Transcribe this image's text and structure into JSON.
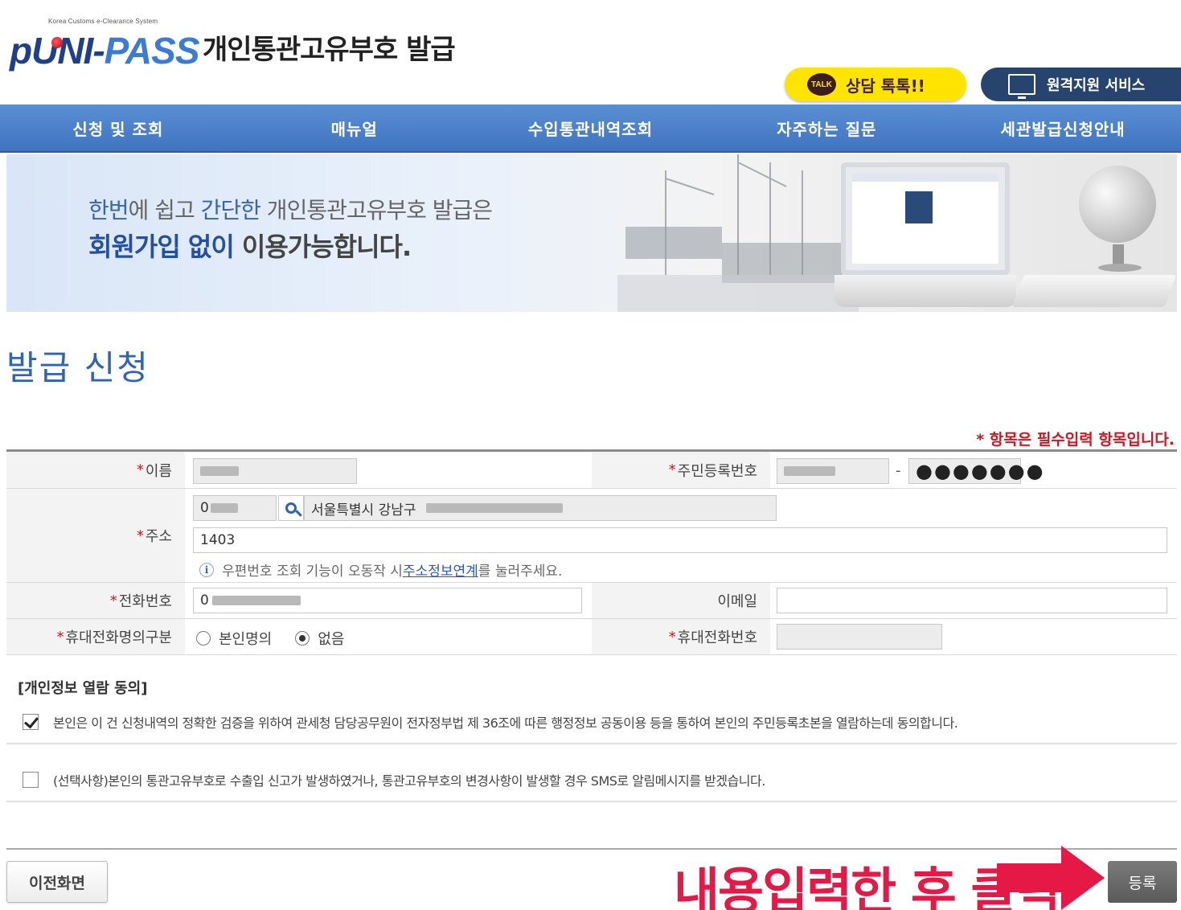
{
  "header": {
    "logo_small_text": "Korea Customs e-Clearance System",
    "logo_p": "p",
    "logo_uni": "UNI-",
    "logo_pass": "PASS",
    "title": "개인통관고유부호 발급",
    "talk_icon_text": "TALK",
    "talk_label": "상담 톡톡!!",
    "remote_label": "원격지원 서비스"
  },
  "nav": {
    "items": [
      {
        "label": "신청 및 조회"
      },
      {
        "label": "매뉴얼"
      },
      {
        "label": "수입통관내역조회"
      },
      {
        "label": "자주하는 질문"
      },
      {
        "label": "세관발급신청안내"
      }
    ]
  },
  "banner": {
    "line1_hl1": "한번",
    "line1_t1": "에 쉽고 ",
    "line1_hl2": "간단한",
    "line1_t2": " 개인통관고유부호 발급은",
    "line2_hl": "회원가입 없이",
    "line2_t": " 이용가능합니다."
  },
  "section_title": "발급 신청",
  "required_note": "* 항목은 필수입력 항목입니다.",
  "form": {
    "req_mark": "*",
    "name_label": "이름",
    "rrn_label": "주민등록번호",
    "rrn_dash": "-",
    "rrn_back": "●●●●●●●",
    "address_label": "주소",
    "zip_value": "0",
    "address_base": "서울특별시 강남구",
    "address_detail": "1403",
    "hint_before": "우편번호 조회 기능이 오동작 시 ",
    "hint_link": "주소정보연계",
    "hint_after": "를 눌러주세요.",
    "info_icon_glyph": "i",
    "phone_label": "전화번호",
    "phone_value": "0",
    "email_label": "이메일",
    "mobile_owner_label": "휴대전화명의구분",
    "radio_self": "본인명의",
    "radio_none": "없음",
    "radio_selected": "없음",
    "mobile_label": "휴대전화번호"
  },
  "consent": {
    "title": "[개인정보 열람 동의]",
    "item1": "본인은 이 건 신청내역의 정확한 검증을 위하여 관세청 담당공무원이 전자정부법 제 36조에 따른 행정정보 공동이용 등을 통하여 본인의 주민등록초본을 열람하는데 동의합니다.",
    "item1_checked": true,
    "item2": "(선택사항)본인의 통관고유부호로 수출입 신고가 발생하였거나, 통관고유부호의 변경사항이 발생할 경우 SMS로 알림메시지를 받겠습니다.",
    "item2_checked": false
  },
  "footer": {
    "prev_label": "이전화면",
    "register_label": "등록",
    "annotation": "내용입력한 후 클릭"
  },
  "colors": {
    "nav": "#4a80c9",
    "accent_blue": "#2f63b7",
    "required_red": "#d0161f",
    "annotation_red": "#e51846",
    "talk_yellow": "#ffe400",
    "remote_navy": "#27446e"
  }
}
